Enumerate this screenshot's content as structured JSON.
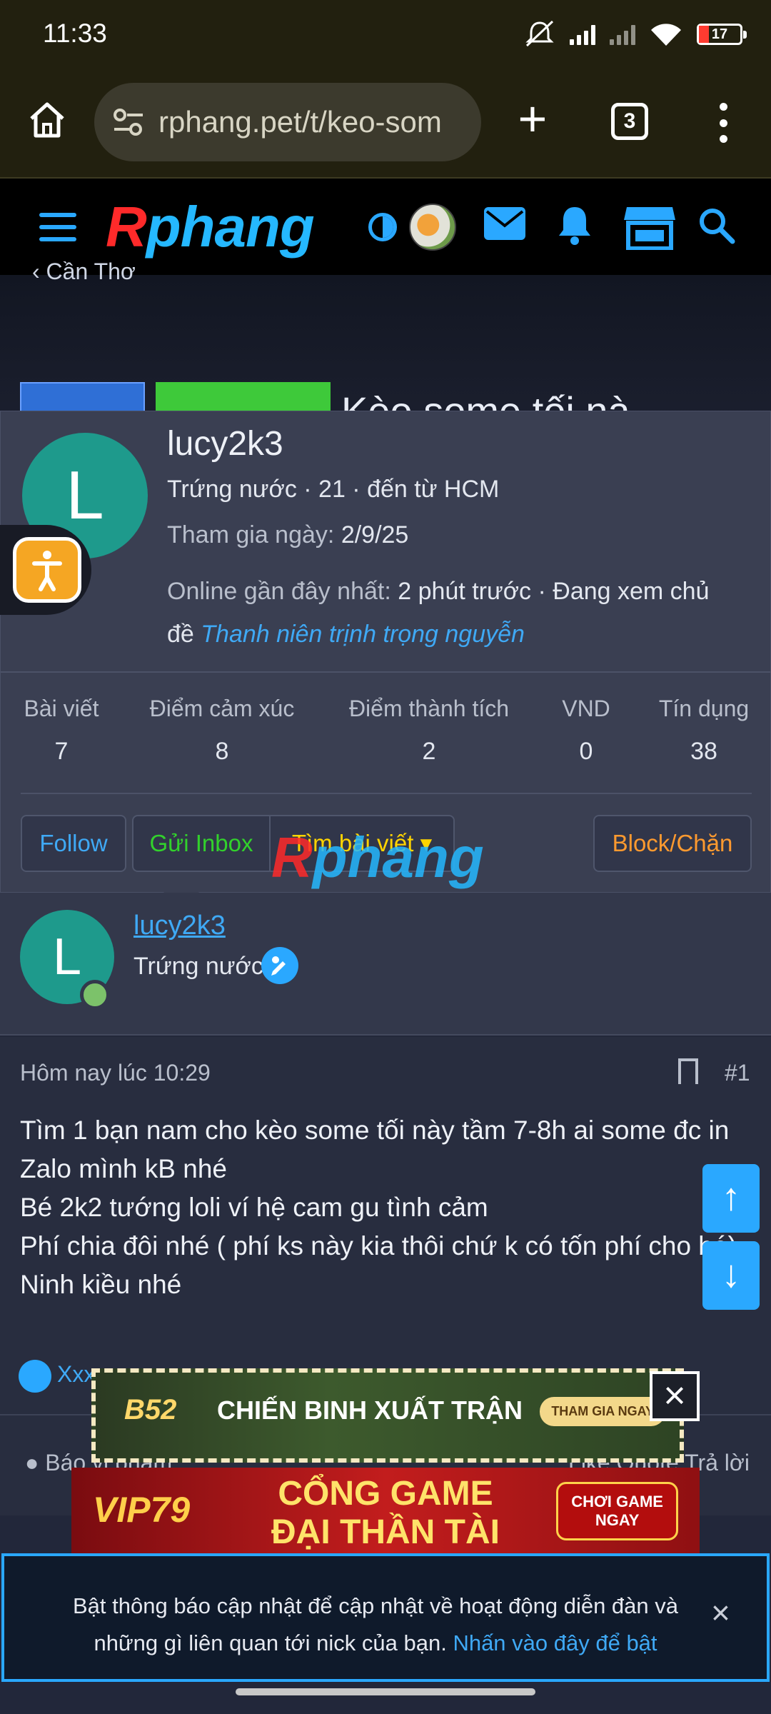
{
  "status": {
    "time": "11:33",
    "battery": "17"
  },
  "browser": {
    "url": "rphang.pet/t/keo-som",
    "tab_count": "3"
  },
  "site": {
    "logo_first": "R",
    "logo_rest": "phang",
    "breadcrumb": "Cần Thơ",
    "title_partial": "Kèo some tối nà"
  },
  "member_card": {
    "username": "lucy2k3",
    "avatar_letter": "L",
    "meta": "Trứng nước · 21 · đến từ HCM",
    "joined_label": "Tham gia ngày:",
    "joined_value": "2/9/25",
    "online_label": "Online gần đây nhất:",
    "online_value": "2 phút trước · Đang xem chủ đề",
    "online_thread": "Thanh niên trịnh trọng nguyễn",
    "stats": [
      {
        "label": "Bài viết",
        "value": "7"
      },
      {
        "label": "Điểm cảm xúc",
        "value": "8"
      },
      {
        "label": "Điểm thành tích",
        "value": "2"
      },
      {
        "label": "VND",
        "value": "0"
      },
      {
        "label": "Tín dụng",
        "value": "38"
      }
    ],
    "buttons": {
      "follow": "Follow",
      "inbox": "Gửi Inbox",
      "find": "Tìm bài viết ▾",
      "block": "Block/Chặn"
    }
  },
  "post": {
    "username": "lucy2k3",
    "avatar_letter": "L",
    "role": "Trứng nước",
    "time": "Hôm nay lúc 10:29",
    "number": "#1",
    "lines": [
      "Tìm 1 bạn nam cho kèo some tối này tầm 7-8h ai some đc in Zalo mình kB nhé",
      "Bé 2k2 tướng loli ví hệ cam gu tình cảm",
      "Phí chia đôi nhé ( phí ks này kia thôi chứ k có tốn phí cho bé)",
      "Ninh kiều nhé"
    ],
    "reactions": "Xxx",
    "report": "Báo vi phạm",
    "actions": "Like   Quote   Trả lời"
  },
  "ads": {
    "b52_logo": "B52",
    "b52_text": "CHIẾN BINH XUẤT TRẬN",
    "b52_cta": "THAM GIA NGAY",
    "vip_logo": "VIP79",
    "vip_text": "CỔNG GAME\nĐẠI THẦN TÀI",
    "vip_cta": "CHƠI GAME\nNGAY"
  },
  "notification": {
    "text": "Bật thông báo cập nhật để cập nhật về hoạt động diễn đàn và những gì liên quan tới nick của bạn.",
    "link": "Nhấn vào đây để bật"
  },
  "colors": {
    "accent": "#2aa8ff",
    "avatar": "#1e9a8c",
    "inbox": "#32d12c",
    "find": "#ffd400",
    "block": "#ff9a2f"
  }
}
